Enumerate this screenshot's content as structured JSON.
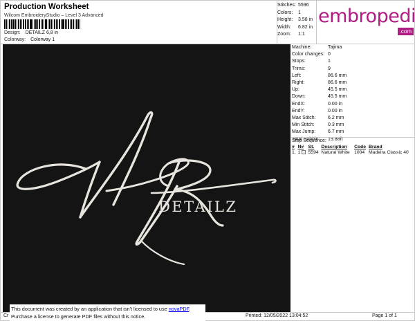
{
  "header": {
    "title": "Production Worksheet",
    "software": "Wilcom EmbroideryStudio – Level 3 Advanced",
    "design_label": "Design:",
    "design_value": "DETAILZ 6,8 in",
    "colorway_label": "Colorway:",
    "colorway_value": "Colorway 1"
  },
  "summary": [
    {
      "label": "Stitches:",
      "value": "5596"
    },
    {
      "label": "Colors:",
      "value": "1"
    },
    {
      "label": "Height:",
      "value": "3.58 in"
    },
    {
      "label": "Width:",
      "value": "6.82 in"
    },
    {
      "label": "Zoom:",
      "value": "1:1"
    }
  ],
  "logo": {
    "text": "embropedia",
    "suffix": ".com",
    "color": "#b01b84"
  },
  "design": {
    "text": "DETAILZ",
    "background": "#141414",
    "thread_color": "#e6e4dc"
  },
  "machine_info": [
    {
      "label": "Machine:",
      "value": "Tajima"
    },
    {
      "label": "Color changes:",
      "value": "0"
    },
    {
      "label": "Stops:",
      "value": "1"
    },
    {
      "label": "Trims:",
      "value": "9"
    },
    {
      "label": "Left:",
      "value": "86.6 mm"
    },
    {
      "label": "Right:",
      "value": "86.6 mm"
    },
    {
      "label": "Up:",
      "value": "45.5 mm"
    },
    {
      "label": "Down:",
      "value": "45.5 mm"
    },
    {
      "label": "EndX:",
      "value": "0.00 in"
    },
    {
      "label": "EndY:",
      "value": "0.00 in"
    },
    {
      "label": "Max Stitch:",
      "value": "6.2 mm"
    },
    {
      "label": "Min Stitch:",
      "value": "0.3 mm"
    },
    {
      "label": "Max Jump:",
      "value": "6.7 mm"
    },
    {
      "label": "Total Bobbin:",
      "value": "19.88ft"
    }
  ],
  "stop_sequence": {
    "title": "Stop Sequence:",
    "columns": [
      "#",
      "N#",
      "St.",
      "Description",
      "Code",
      "Brand"
    ],
    "rows": [
      {
        "num": "1.",
        "n": "1",
        "st": "5594",
        "description": "Natural White",
        "code": "1004",
        "brand": "Madeira Classic 40"
      }
    ]
  },
  "notice": {
    "line1_prefix": "This document was created by an application that isn't licensed to use ",
    "link": "novaPDF",
    "line1_suffix": ".",
    "line2": "Purchase a license to generate PDF files without this notice."
  },
  "footer": {
    "left": "Cr",
    "printed": "Printed:  12/05/2022 13:04:52",
    "page": "Page 1 of 1"
  }
}
